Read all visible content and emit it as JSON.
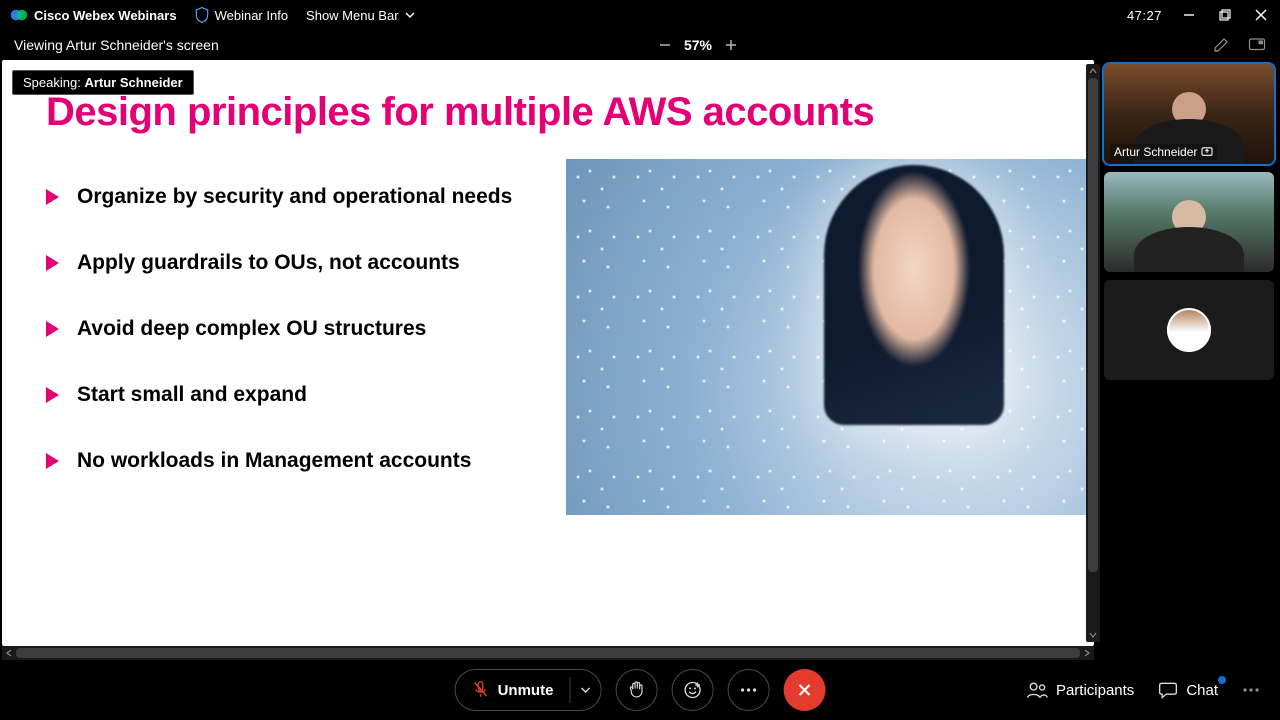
{
  "topbar": {
    "brand": "Cisco Webex Webinars",
    "webinar_info": "Webinar Info",
    "menu_bar": "Show Menu Bar",
    "elapsed": "47:27"
  },
  "subbar": {
    "viewing": "Viewing Artur Schneider's screen",
    "zoom": "57%"
  },
  "speaking": {
    "prefix": "Speaking:",
    "name": "Artur Schneider"
  },
  "slide": {
    "title": "Design principles for multiple AWS accounts",
    "bullets": [
      "Organize by security and operational needs",
      "Apply guardrails to OUs, not accounts",
      "Avoid deep complex OU structures",
      "Start small and expand",
      "No workloads in Management accounts"
    ]
  },
  "videos": [
    {
      "name": "Artur Schneider",
      "sharing": true
    },
    {
      "name": ""
    },
    {
      "name": ""
    }
  ],
  "controls": {
    "unmute": "Unmute",
    "participants": "Participants",
    "chat": "Chat"
  },
  "colors": {
    "accent_magenta": "#e20074",
    "leave_red": "#e43b2f",
    "active_blue": "#1170cf"
  }
}
